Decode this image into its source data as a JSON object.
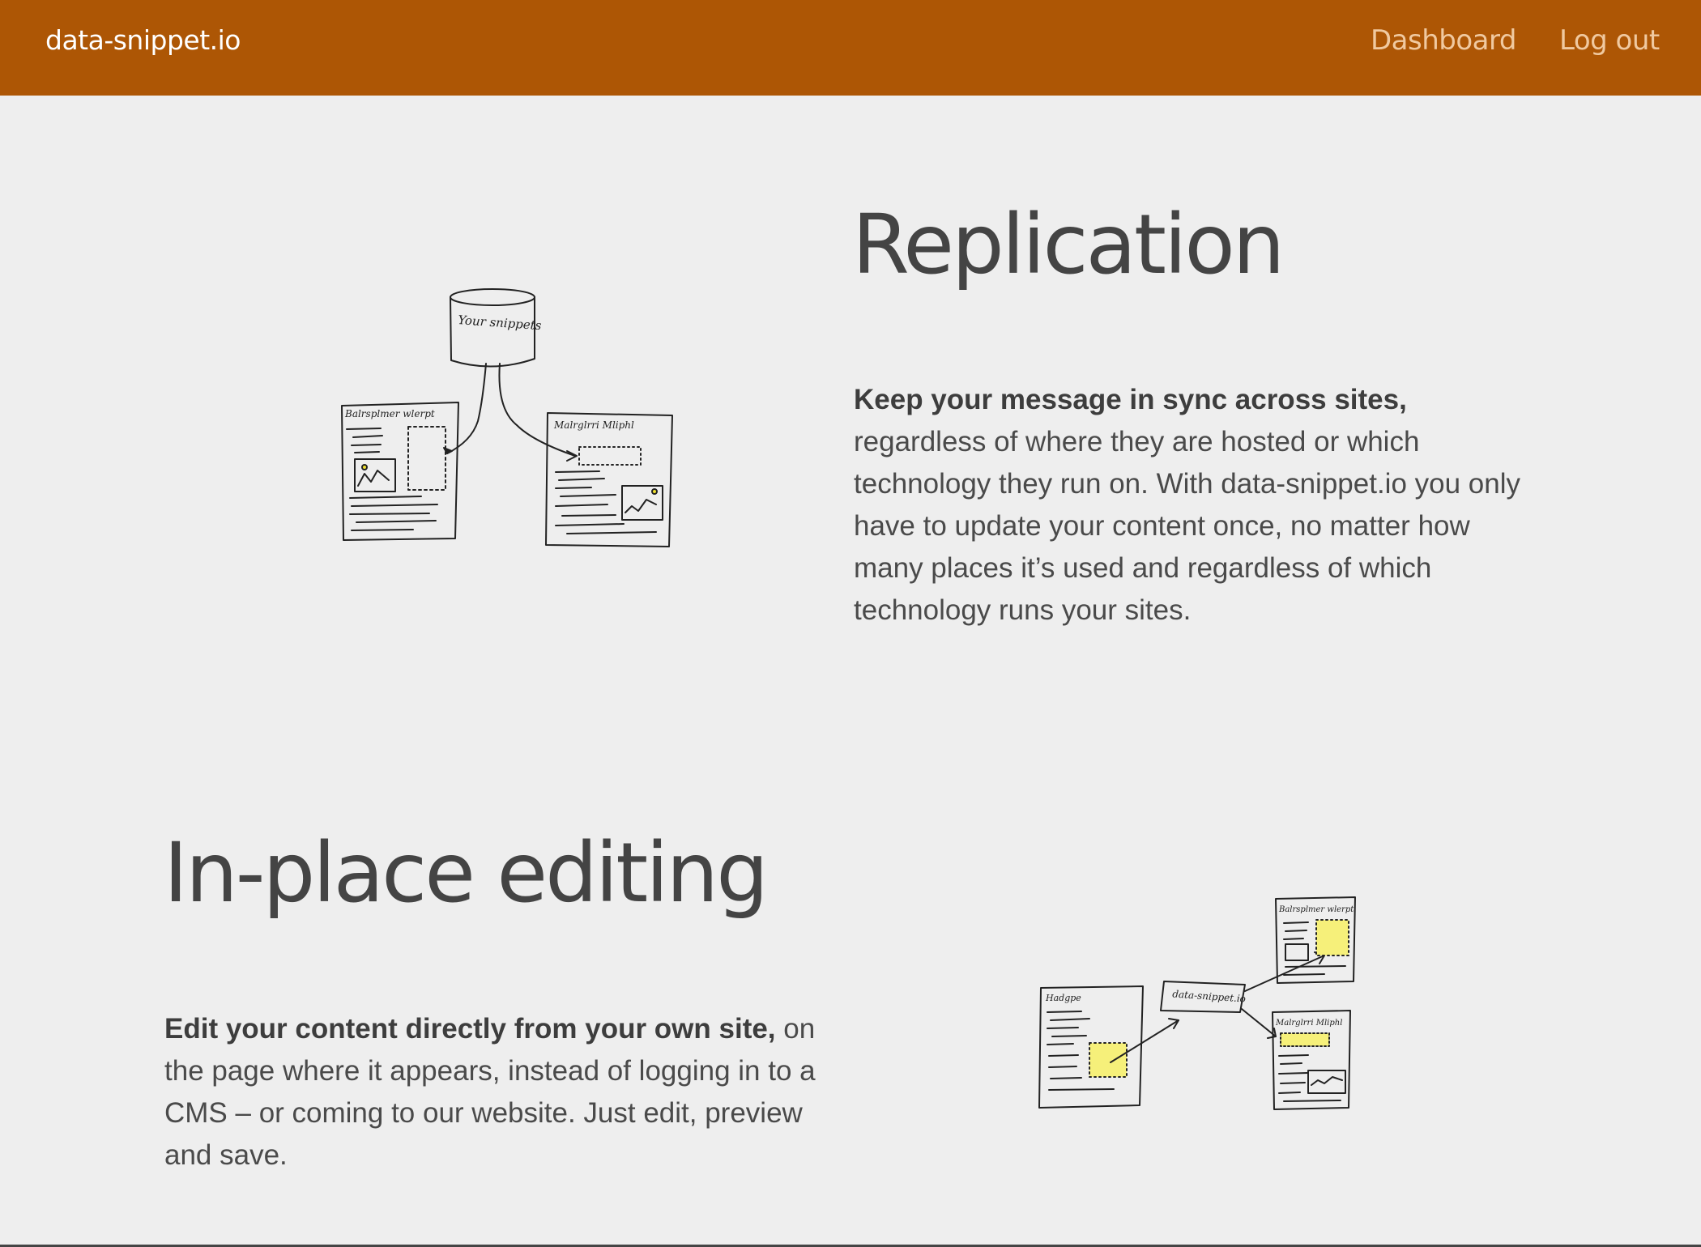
{
  "navbar": {
    "brand": "data-snippet.io",
    "links": [
      {
        "label": "Dashboard"
      },
      {
        "label": "Log out"
      }
    ],
    "background_color": "#ad5605"
  },
  "sections": [
    {
      "title": "Replication",
      "lead": "Keep your message in sync across sites,",
      "body": "regardless of where they are hosted or which technology they run on. With data-snippet.io you only have to update your content once, no matter how many places it’s used and regardless of which technology runs your sites.",
      "illustration": {
        "icon": "replication-sketch",
        "labels": [
          "Your snippets",
          "Balrsplmer wlerpt",
          "Malrglrri Mliphl"
        ]
      }
    },
    {
      "title": "In-place editing",
      "lead": "Edit your content directly from your own site,",
      "body": " on the page where it appears, instead of logging in to a CMS – or coming to our website. Just edit, preview and save.",
      "illustration": {
        "icon": "in-place-editing-sketch",
        "labels": [
          "Hadgpe",
          "data-snippet.io",
          "Balrsplmer wlerpt",
          "Malrglrri Mliphl"
        ]
      }
    }
  ]
}
